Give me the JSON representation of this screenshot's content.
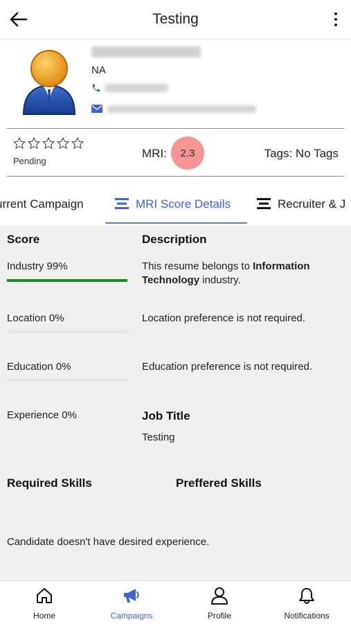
{
  "header": {
    "title": "Testing"
  },
  "candidate": {
    "location": "NA"
  },
  "rating": {
    "status": "Pending",
    "stars_filled": 0,
    "stars_total": 5
  },
  "mri": {
    "label": "MRI:",
    "value": "2.3",
    "badge_color": "#f59595"
  },
  "tags": {
    "text": "Tags: No Tags"
  },
  "tabs": [
    {
      "label": "urrent Campaign"
    },
    {
      "label": "MRI Score Details",
      "active": true
    },
    {
      "label": "Recruiter & J"
    }
  ],
  "score_table": {
    "score_header": "Score",
    "description_header": "Description",
    "rows": [
      {
        "label": "Industry  99%",
        "percent": 99,
        "desc_prefix": "This resume belongs to ",
        "desc_bold": "Information Technology",
        "desc_suffix": " industry."
      },
      {
        "label": "Location  0%",
        "percent": 0,
        "description": "Location preference is not required."
      },
      {
        "label": "Education  0%",
        "percent": 0,
        "description": "Education preference is not required."
      },
      {
        "label": "Experience  0%",
        "percent": 0
      }
    ],
    "bar_color": "#1e8a1e",
    "job_title_header": "Job Title",
    "job_title": "Testing",
    "required_skills_header": "Required Skills",
    "preferred_skills_header": "Preffered Skills",
    "note": "Candidate doesn't have desired experience."
  },
  "nav": {
    "items": [
      {
        "label": "Home",
        "icon": "home-icon"
      },
      {
        "label": "Campaigns",
        "icon": "megaphone-icon",
        "active": true
      },
      {
        "label": "Profile",
        "icon": "user-icon"
      },
      {
        "label": "Notifications",
        "icon": "bell-icon"
      }
    ],
    "active_color": "#3e63d8"
  }
}
